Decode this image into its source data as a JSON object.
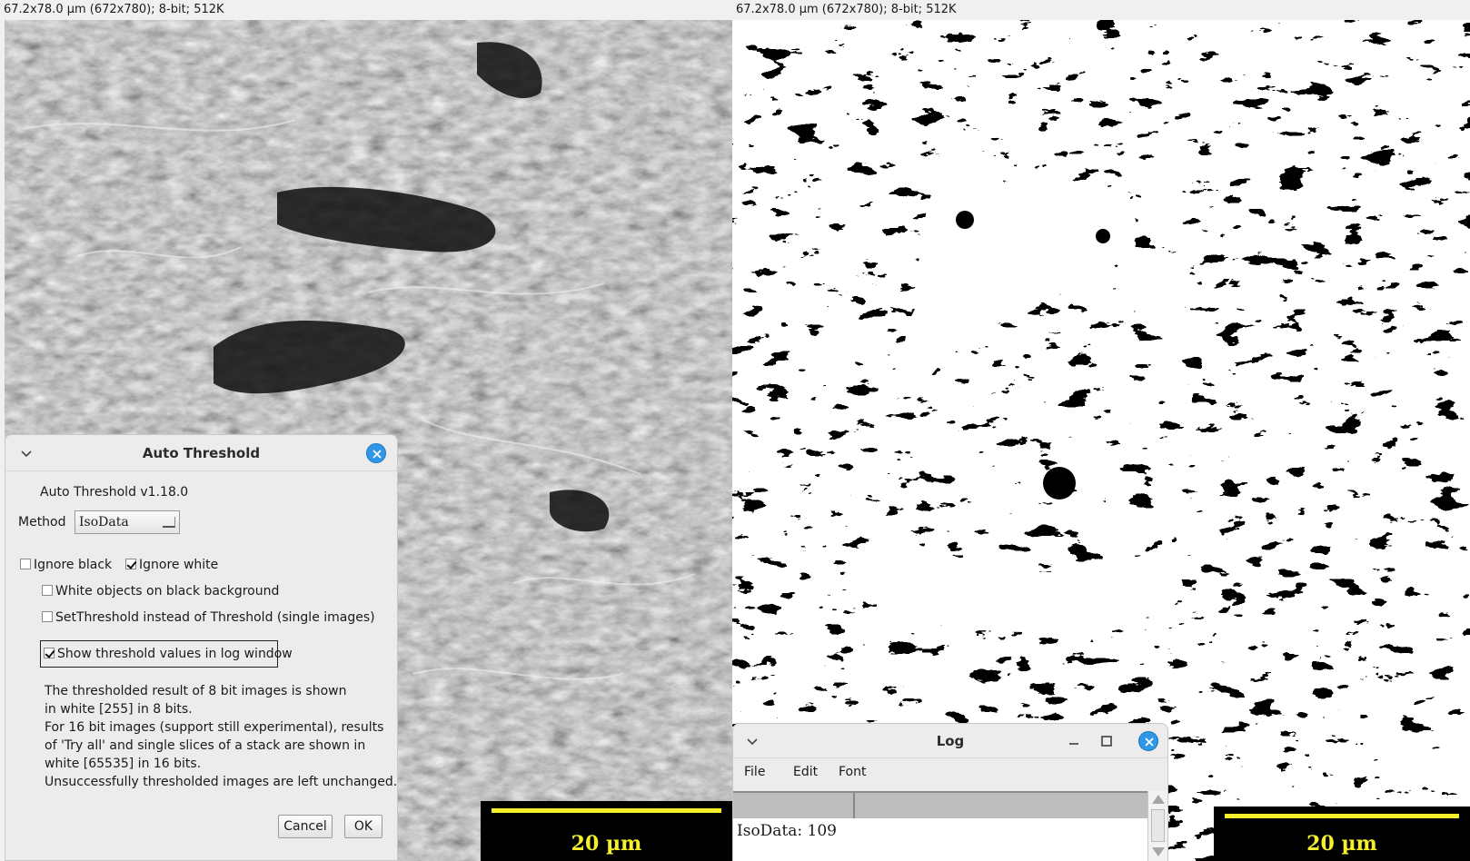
{
  "left_window": {
    "info": "67.2x78.0 µm (672x780); 8-bit; 512K",
    "scale_label": "20 µm",
    "image_description_icon": "sem-micrograph-image"
  },
  "right_window": {
    "info": "67.2x78.0 µm (672x780); 8-bit; 512K",
    "scale_label": "20 µm",
    "image_description_icon": "binary-threshold-image"
  },
  "dialog": {
    "title": "Auto Threshold",
    "version": "Auto Threshold v1.18.0",
    "method_label": "Method",
    "method_value": "IsoData",
    "checkboxes": {
      "ignore_black": {
        "label": "Ignore black",
        "checked": false
      },
      "ignore_white": {
        "label": "Ignore white",
        "checked": true
      },
      "white_objects": {
        "label": "White objects on black background",
        "checked": false
      },
      "set_threshold": {
        "label": "SetThreshold instead of Threshold (single images)",
        "checked": false
      },
      "show_log": {
        "label": "Show threshold values in log window",
        "checked": true
      }
    },
    "notes": [
      "The thresholded result of 8 bit images is shown",
      "in white [255] in 8 bits.",
      "For 16 bit images (support still experimental), results",
      "of 'Try all' and single slices of a stack are shown in",
      "white [65535] in 16 bits.",
      "Unsuccessfully thresholded images are left unchanged."
    ],
    "cancel_label": "Cancel",
    "ok_label": "OK"
  },
  "log": {
    "title": "Log",
    "menu": [
      "File",
      "Edit",
      "Font"
    ],
    "lines": [
      "IsoData: 109"
    ]
  },
  "colors": {
    "accent_close": "#2f97e6",
    "scale_bar_text": "#f5f02a",
    "scale_bar_bg": "#000000"
  }
}
